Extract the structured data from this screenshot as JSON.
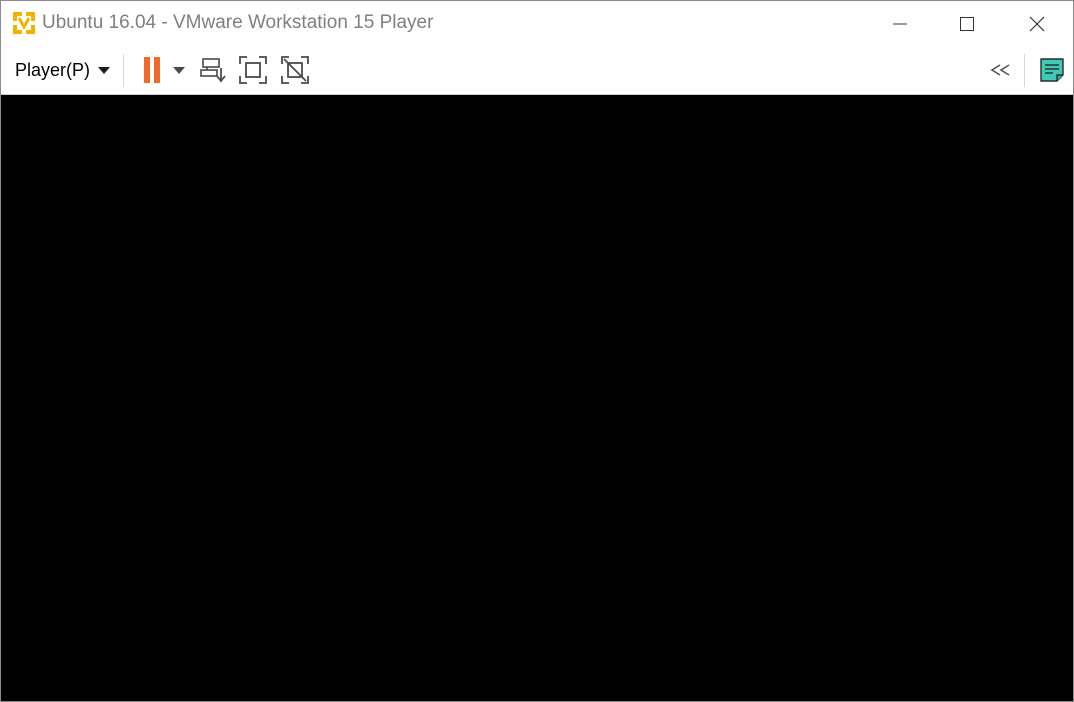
{
  "window": {
    "title": "Ubuntu 16.04 - VMware Workstation 15 Player",
    "app_icon": "vmware-player-icon",
    "controls": {
      "minimize": "minimize-icon",
      "maximize": "maximize-icon",
      "close": "close-icon"
    }
  },
  "toolbar": {
    "player_menu_label": "Player(P)",
    "buttons": [
      {
        "name": "pause-button",
        "icon": "pause-icon",
        "color": "#f26a2b"
      },
      {
        "name": "power-options-dropdown",
        "icon": "chevron-down-icon"
      },
      {
        "name": "send-ctrl-alt-del-button",
        "icon": "send-keys-icon"
      },
      {
        "name": "full-screen-button",
        "icon": "fullscreen-icon"
      },
      {
        "name": "unity-button",
        "icon": "unity-disabled-icon"
      }
    ],
    "right_buttons": [
      {
        "name": "collapse-toolbar-button",
        "icon": "double-chevron-left-icon"
      },
      {
        "name": "message-log-button",
        "icon": "notes-icon",
        "color": "#3ec9b8"
      }
    ]
  },
  "colors": {
    "accent_orange": "#f26a2b",
    "accent_teal": "#3ec9b8",
    "icon_yellow": "#f0b400",
    "vm_screen": "#000000"
  }
}
